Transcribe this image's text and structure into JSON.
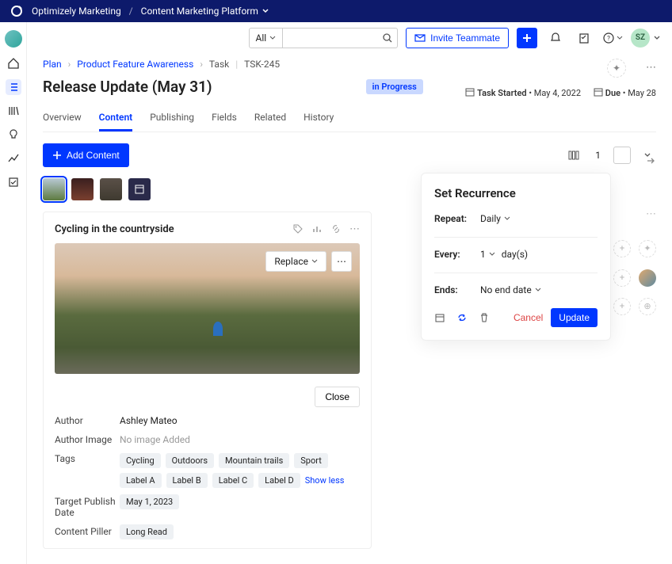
{
  "topbar": {
    "brand": "Optimizely Marketing",
    "product": "Content Marketing Platform"
  },
  "toolbar": {
    "searchScope": "All",
    "invite": "Invite Teammate",
    "userInitials": "SZ"
  },
  "breadcrumb": {
    "plan": "Plan",
    "feature": "Product Feature Awareness",
    "task": "Task",
    "id": "TSK-245"
  },
  "page": {
    "title": "Release Update (May 31)",
    "status": "in Progress"
  },
  "dates": {
    "startedLabel": "Task Started",
    "startedValue": "May 4, 2022",
    "dueLabel": "Due",
    "dueValue": "May 28"
  },
  "tabs": [
    "Overview",
    "Content",
    "Publishing",
    "Fields",
    "Related",
    "History"
  ],
  "contentbar": {
    "add": "Add Content",
    "count": "1"
  },
  "card": {
    "title": "Cycling in the countryside",
    "replace": "Replace",
    "close": "Close",
    "authorLabel": "Author",
    "author": "Ashley Mateo",
    "authorImgLabel": "Author Image",
    "authorImg": "No image Added",
    "tagsLabel": "Tags",
    "tags": [
      "Cycling",
      "Outdoors",
      "Mountain trails",
      "Sport",
      "Label A",
      "Label B",
      "Label C",
      "Label D"
    ],
    "showless": "Show less",
    "pubLabel": "Target Publish Date",
    "pubDate": "May 1, 2023",
    "pillerLabel": "Content Piller",
    "piller": "Long Read"
  },
  "modal": {
    "title": "Set Recurrence",
    "repeatLabel": "Repeat:",
    "repeatValue": "Daily",
    "everyLabel": "Every:",
    "everyValue": "1",
    "everyUnit": "day(s)",
    "endsLabel": "Ends:",
    "endsValue": "No end date",
    "cancel": "Cancel",
    "update": "Update"
  }
}
